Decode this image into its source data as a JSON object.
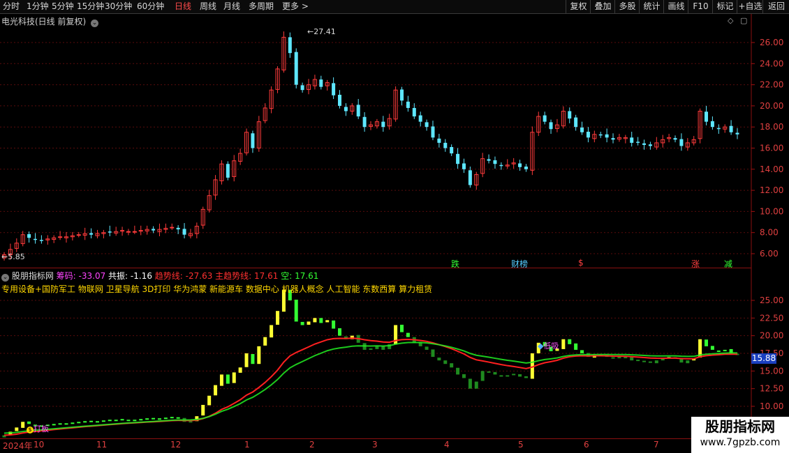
{
  "toolbar": {
    "periods": [
      "分时",
      "1分钟",
      "5分钟",
      "15分钟",
      "30分钟",
      "60分钟",
      "日线",
      "周线",
      "月线",
      "多周期",
      "更多 >"
    ],
    "active_period": "日线",
    "right_buttons": [
      "复权",
      "叠加",
      "多股",
      "统计",
      "画线",
      "F10",
      "标记",
      "+自选",
      "返回"
    ]
  },
  "main_chart": {
    "title": "电光科技(日线 前复权)",
    "high_label": "27.41",
    "low_label": "5.85",
    "y_ticks": [
      "26.00",
      "24.00",
      "22.00",
      "20.00",
      "18.00",
      "16.00",
      "14.00",
      "12.00",
      "10.00",
      "8.00",
      "6.00"
    ],
    "events": [
      {
        "text": "跌",
        "color": "#33ff33"
      },
      {
        "text": "财榜",
        "color": "#55ccff"
      },
      {
        "text": "$",
        "color": "#ff4040"
      },
      {
        "text": "涨",
        "color": "#ff4040"
      },
      {
        "text": "减",
        "color": "#33ff33"
      }
    ]
  },
  "indicator": {
    "name": "股朋指标网",
    "chip_label": "筹码: -33.07",
    "resonance_label": "共振: -1.16",
    "trend_label": "趋势线: -27.63",
    "main_trend_label": "主趋势线: 17.61",
    "short_label": "空: 17.61",
    "concepts": "专用设备+国防军工 物联网 卫星导航 3D打印 华为鸿蒙 新能源车 数据中心 机器人概念 人工智能 东数西算 算力租赁",
    "y_ticks": [
      "25.00",
      "22.50",
      "20.00",
      "17.50",
      "15.00",
      "12.50",
      "10.00"
    ],
    "current_value": "15.88",
    "annotations": [
      "打板",
      "低吸"
    ]
  },
  "x_axis": {
    "labels": [
      "2024年",
      "10",
      "11",
      "12",
      "1",
      "2",
      "3",
      "4",
      "5",
      "6",
      "7"
    ]
  },
  "watermark": {
    "line1": "股朋指标网",
    "line2": "www.7gpzb.com"
  },
  "chart_data": {
    "type": "candlestick",
    "title": "电光科技(日线 前复权)",
    "ylim": [
      5.5,
      27.5
    ],
    "high": 27.41,
    "low": 5.85,
    "close_series_approx": [
      5.9,
      6.4,
      7.0,
      7.8,
      7.5,
      7.3,
      7.2,
      7.4,
      7.5,
      7.6,
      7.6,
      7.7,
      7.8,
      7.9,
      7.8,
      7.9,
      8.0,
      8.0,
      8.1,
      8.2,
      8.1,
      8.1,
      8.2,
      8.3,
      8.2,
      8.3,
      8.4,
      8.5,
      8.3,
      7.8,
      7.9,
      8.6,
      10.2,
      11.5,
      13.0,
      14.5,
      13.2,
      14.8,
      15.5,
      17.5,
      16.0,
      18.5,
      19.8,
      21.5,
      23.5,
      26.5,
      25.0,
      22.0,
      21.5,
      22.0,
      22.5,
      21.8,
      22.2,
      21.0,
      20.0,
      19.5,
      20.0,
      19.0,
      18.0,
      18.2,
      18.5,
      18.0,
      18.8,
      21.5,
      20.5,
      19.8,
      19.0,
      18.5,
      18.0,
      17.0,
      16.5,
      16.0,
      15.5,
      14.5,
      14.0,
      12.5,
      13.5,
      15.0,
      14.8,
      14.5,
      14.3,
      14.4,
      14.6,
      14.2,
      14.0,
      17.5,
      19.0,
      18.5,
      17.8,
      18.2,
      19.5,
      18.8,
      18.0,
      17.5,
      17.0,
      17.3,
      17.2,
      17.0,
      16.8,
      17.0,
      17.0,
      16.5,
      16.5,
      16.3,
      16.2,
      16.5,
      16.8,
      17.0,
      16.8,
      16.2,
      16.5,
      16.8,
      19.5,
      18.5,
      18.0,
      17.8,
      18.0,
      17.5,
      17.3
    ]
  }
}
